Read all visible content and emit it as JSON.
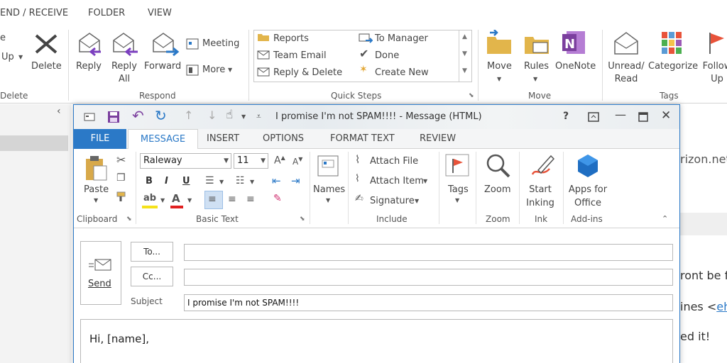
{
  "background_window": {
    "tabs": [
      "END / RECEIVE",
      "FOLDER",
      "VIEW"
    ],
    "groups": {
      "delete": {
        "label": "Delete",
        "buttons": [
          "e",
          "Up",
          "Delete"
        ]
      },
      "respond": {
        "label": "Respond",
        "buttons": [
          "Reply",
          "Reply All",
          "Forward",
          "Meeting",
          "More"
        ]
      },
      "quick_steps": {
        "label": "Quick Steps",
        "items": [
          "Reports",
          "Team Email",
          "Reply & Delete",
          "To Manager",
          "Done",
          "Create New"
        ]
      },
      "move": {
        "label": "Move",
        "buttons": [
          "Move",
          "Rules",
          "OneNote"
        ]
      },
      "tags": {
        "label": "Tags",
        "buttons": [
          "Unread/ Read",
          "Categorize",
          "Follow Up"
        ]
      }
    },
    "right_pane_fragments": [
      "rizon.net",
      "ront be f",
      "ines <eh",
      "ed it!"
    ]
  },
  "message_window": {
    "title": "I promise I'm not SPAM!!!! - Message (HTML)",
    "title_controls": [
      "?",
      "▢",
      "—",
      "☐",
      "✕"
    ],
    "tabs": [
      "FILE",
      "MESSAGE",
      "INSERT",
      "OPTIONS",
      "FORMAT TEXT",
      "REVIEW"
    ],
    "ribbon": {
      "clipboard": {
        "label": "Clipboard",
        "paste": "Paste"
      },
      "basic_text": {
        "label": "Basic Text",
        "font": "Raleway",
        "size": "11",
        "bold": "B",
        "italic": "I",
        "underline": "U"
      },
      "names": {
        "label": "Names"
      },
      "include": {
        "label": "Include",
        "attach_file": "Attach File",
        "attach_item": "Attach Item",
        "signature": "Signature"
      },
      "tags": {
        "label": "Tags"
      },
      "zoom": {
        "label": "Zoom",
        "button": "Zoom"
      },
      "ink": {
        "label": "Ink",
        "button": "Start Inking"
      },
      "addins": {
        "label": "Add-ins",
        "button": "Apps for Office"
      }
    },
    "compose": {
      "send": "Send",
      "to_label": "To...",
      "cc_label": "Cc...",
      "subject_label": "Subject",
      "to_value": "",
      "cc_value": "",
      "subject_value": "I promise I'm not SPAM!!!!",
      "body_first_line": "Hi, [name],"
    }
  },
  "colors": {
    "accent": "#2b79c7",
    "ribbon_bg": "#ffffff",
    "window_border": "#2b79c7"
  }
}
